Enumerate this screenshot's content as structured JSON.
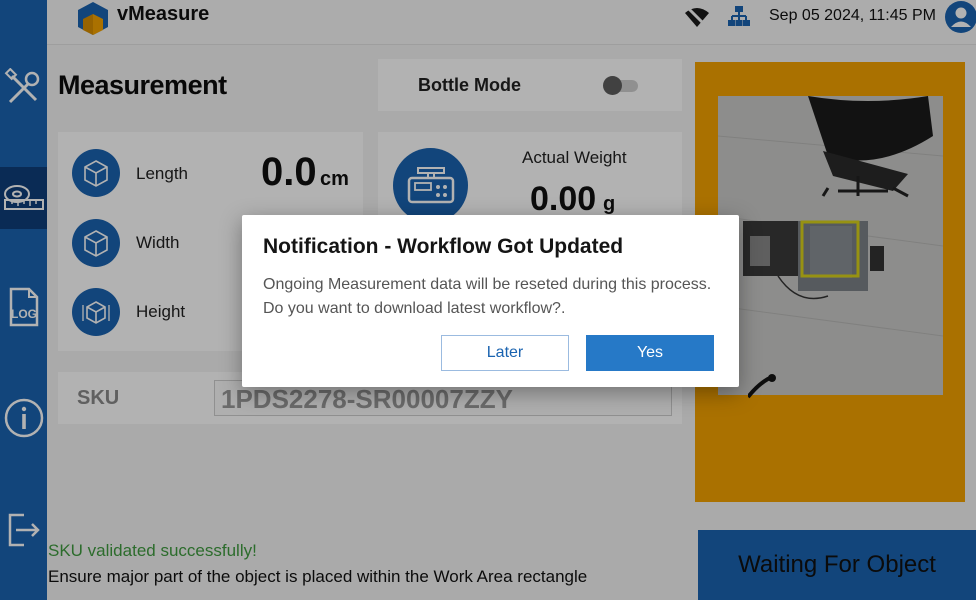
{
  "app": {
    "name": "vMeasure",
    "datetime": "Sep 05 2024, 11:45 PM"
  },
  "sidebar": {
    "items": [
      {
        "name": "tools-icon",
        "active": false
      },
      {
        "name": "measure-tape-icon",
        "active": true
      },
      {
        "name": "log-icon",
        "label": "LOG",
        "active": false
      },
      {
        "name": "info-icon",
        "active": false
      },
      {
        "name": "logout-icon",
        "active": false
      }
    ]
  },
  "header": {
    "icons": [
      "wifi-off-icon",
      "network-icon",
      "user-avatar-icon"
    ]
  },
  "measurement": {
    "title": "Measurement",
    "bottle_mode_label": "Bottle Mode",
    "bottle_mode_on": false,
    "length_label": "Length",
    "width_label": "Width",
    "height_label": "Height",
    "length_value": "0.0",
    "length_unit": "cm",
    "weight_label": "Actual Weight",
    "weight_value": "0.00",
    "weight_unit": "g",
    "sku_label": "SKU",
    "sku_value": "1PDS2278-SR00007ZZY"
  },
  "status": {
    "ok_message": "SKU validated successfully!",
    "hint_message": "Ensure major part of the object is placed within the Work Area rectangle",
    "action_label": "Waiting For Object"
  },
  "dialog": {
    "title": "Notification - Workflow Got Updated",
    "message_line1": "Ongoing Measurement data will be reseted during this process.",
    "message_line2": "Do you want to download latest workflow?.",
    "later_label": "Later",
    "yes_label": "Yes"
  },
  "colors": {
    "primary": "#1a63b0",
    "sidebar_active": "#0f3e7a",
    "camera_frame": "#f4a300",
    "work_area": "#d8d21a",
    "success_text": "#3f9b3f"
  }
}
